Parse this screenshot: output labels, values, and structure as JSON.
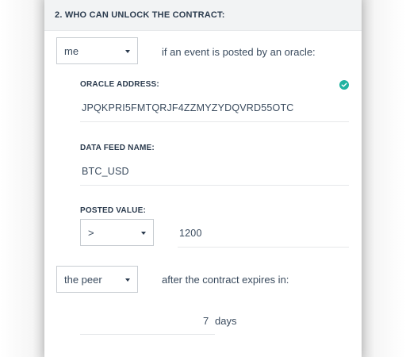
{
  "section": {
    "title": "2. WHO CAN UNLOCK THE CONTRACT:"
  },
  "oracle_rule": {
    "who_select": "me",
    "condition_text": "if an event is posted by an oracle:",
    "oracle_address_label": "ORACLE ADDRESS:",
    "oracle_address_value": "JPQKPRI5FMTQRJF4ZZMYZYDQVRD55OTC",
    "oracle_address_valid": true,
    "data_feed_label": "DATA FEED NAME:",
    "data_feed_value": "BTC_USD",
    "posted_value_label": "POSTED VALUE:",
    "comparison_select": ">",
    "posted_value": "1200"
  },
  "expiry_rule": {
    "who_select": "the peer",
    "condition_text": "after the contract expires in:",
    "days_value": "7",
    "days_unit": "days"
  },
  "colors": {
    "accent_check": "#21b3a1",
    "header_bg": "#f2f3f4",
    "text": "#2b3b4e"
  }
}
